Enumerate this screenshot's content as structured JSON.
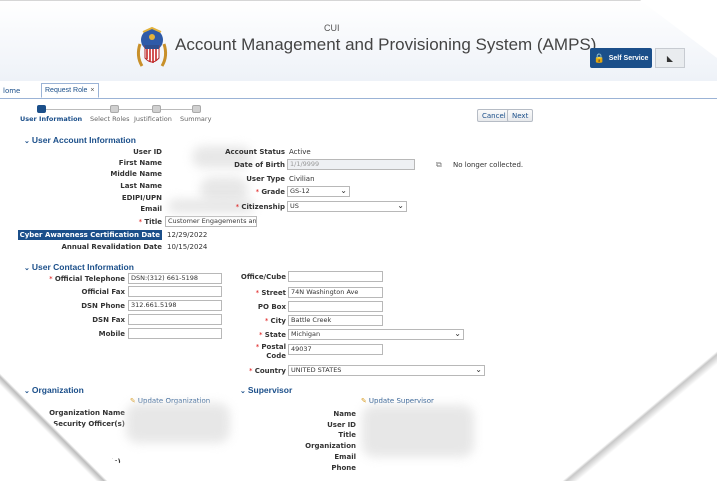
{
  "header": {
    "marking": "CUI",
    "title": "Account Management and Provisioning System (AMPS)",
    "self_service": "Self Service"
  },
  "tabs": [
    {
      "label": "Home",
      "visible_label": "lome"
    },
    {
      "label": "Request Role"
    }
  ],
  "steps": [
    "User Information",
    "Select Roles",
    "Justification",
    "Summary"
  ],
  "actions": {
    "cancel": "Cancel",
    "next": "Next"
  },
  "user_account": {
    "title": "User Account Information",
    "labels": {
      "user_id": "User ID",
      "first_name": "First Name",
      "middle_name": "Middle Name",
      "last_name": "Last Name",
      "edipi": "EDIPI/UPN",
      "email": "Email",
      "title": "Title",
      "cyber": "Cyber Awareness Certification Date",
      "revalidation": "Annual Revalidation Date",
      "account_status": "Account Status",
      "dob": "Date of Birth",
      "user_type": "User Type",
      "grade": "Grade",
      "citizenship": "Citizenship"
    },
    "values": {
      "title": "Customer Engagements and",
      "cyber": "12/29/2022",
      "revalidation": "10/15/2024",
      "account_status": "Active",
      "dob": "1/1/9999",
      "dob_note": "No longer collected.",
      "user_type": "Civilian",
      "grade": "GS-12",
      "citizenship": "US"
    }
  },
  "contact": {
    "title": "User Contact Information",
    "labels": {
      "official_tel": "Official Telephone",
      "official_fax": "Official Fax",
      "dsn_phone": "DSN Phone",
      "dsn_fax": "DSN Fax",
      "mobile": "Mobile",
      "office": "Office/Cube",
      "street": "Street",
      "po_box": "PO Box",
      "city": "City",
      "state": "State",
      "postal_1": "Postal",
      "postal_2": "Code",
      "country": "Country"
    },
    "values": {
      "official_tel": "DSN:(312) 661-5198",
      "dsn_phone": "312.661.5198",
      "street": "74N Washington Ave",
      "city": "Battle Creek",
      "state": "Michigan",
      "postal": "49037",
      "country": "UNITED STATES"
    }
  },
  "organization": {
    "title": "Organization",
    "update": "Update Organization",
    "labels": {
      "name": "Organization Name",
      "security": "Security Officer(s)",
      "other": "Officer(s)"
    }
  },
  "supervisor": {
    "title": "Supervisor",
    "update": "Update Supervisor",
    "labels": {
      "name": "Name",
      "user_id": "User ID",
      "title": "Title",
      "org": "Organization",
      "email": "Email",
      "phone": "Phone"
    }
  }
}
